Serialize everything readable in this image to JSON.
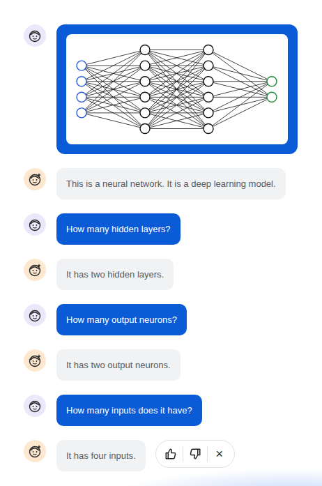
{
  "messages": [
    {
      "sender": "user",
      "kind": "image",
      "layers": [
        {
          "nodes": 4,
          "color": "#2a5bd7"
        },
        {
          "nodes": 6,
          "color": "#111111"
        },
        {
          "nodes": 6,
          "color": "#111111"
        },
        {
          "nodes": 2,
          "color": "#1f8a3a"
        }
      ]
    },
    {
      "sender": "bot",
      "kind": "text",
      "text": "This is a neural network. It is a deep learning model."
    },
    {
      "sender": "user",
      "kind": "text",
      "text": "How many hidden layers?"
    },
    {
      "sender": "bot",
      "kind": "text",
      "text": "It has two hidden layers."
    },
    {
      "sender": "user",
      "kind": "text",
      "text": "How many output neurons?"
    },
    {
      "sender": "bot",
      "kind": "text",
      "text": "It has two output neurons."
    },
    {
      "sender": "user",
      "kind": "text",
      "text": "How many inputs does it have?"
    },
    {
      "sender": "bot",
      "kind": "text",
      "text": "It has four inputs."
    }
  ],
  "feedback": {
    "close": "×"
  }
}
